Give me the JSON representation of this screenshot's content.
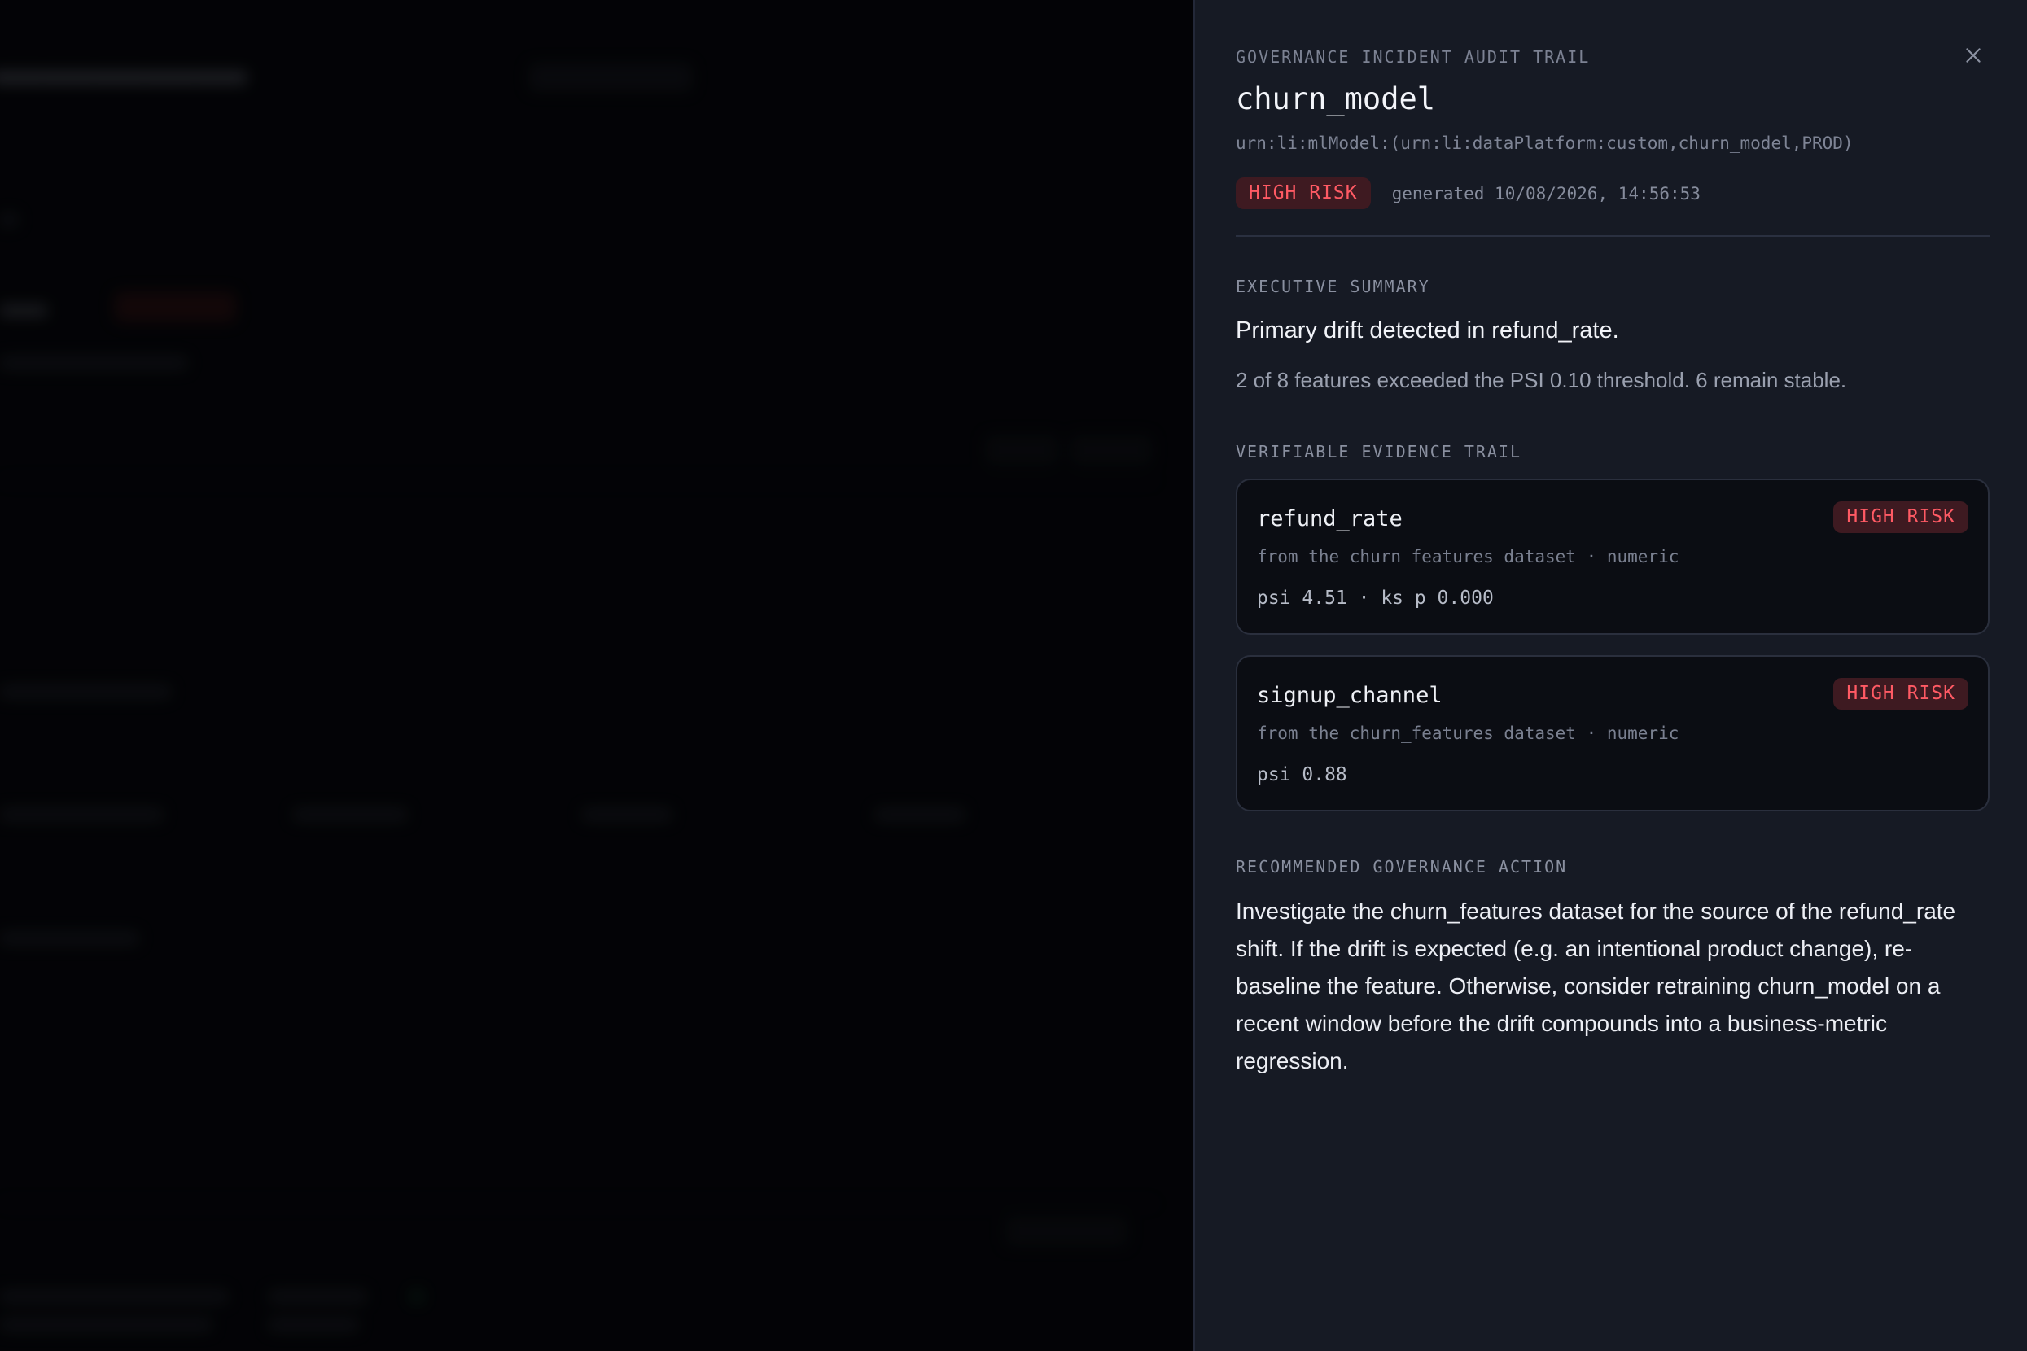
{
  "drawer": {
    "eyebrow": "GOVERNANCE INCIDENT AUDIT TRAIL",
    "model_name": "churn_model",
    "urn": "urn:li:mlModel:(urn:li:dataPlatform:custom,churn_model,PROD)",
    "risk_badge": "HIGH RISK",
    "generated": "generated 10/08/2026, 14:56:53",
    "close_icon": "close-icon"
  },
  "executive_summary": {
    "label": "EXECUTIVE SUMMARY",
    "headline": "Primary drift detected in refund_rate.",
    "detail": "2 of 8 features exceeded the PSI 0.10 threshold. 6 remain stable."
  },
  "evidence": {
    "label": "VERIFIABLE EVIDENCE TRAIL",
    "cards": [
      {
        "feature": "refund_rate",
        "badge": "HIGH RISK",
        "source": "from the churn_features dataset · numeric",
        "metrics": "psi 4.51 · ks p 0.000"
      },
      {
        "feature": "signup_channel",
        "badge": "HIGH RISK",
        "source": "from the churn_features dataset · numeric",
        "metrics": "psi 0.88"
      }
    ]
  },
  "action": {
    "label": "RECOMMENDED GOVERNANCE ACTION",
    "text": "Investigate the churn_features dataset for the source of the refund_rate shift. If the drift is expected (e.g. an intentional product change), re-baseline the feature. Otherwise, consider retraining churn_model on a recent window before the drift compounds into a business-metric regression."
  },
  "colors": {
    "drawer_bg": "#161a24",
    "risk_text": "#ff5a64",
    "risk_bg": "#3e1a21",
    "card_bg": "#0b0d13"
  }
}
